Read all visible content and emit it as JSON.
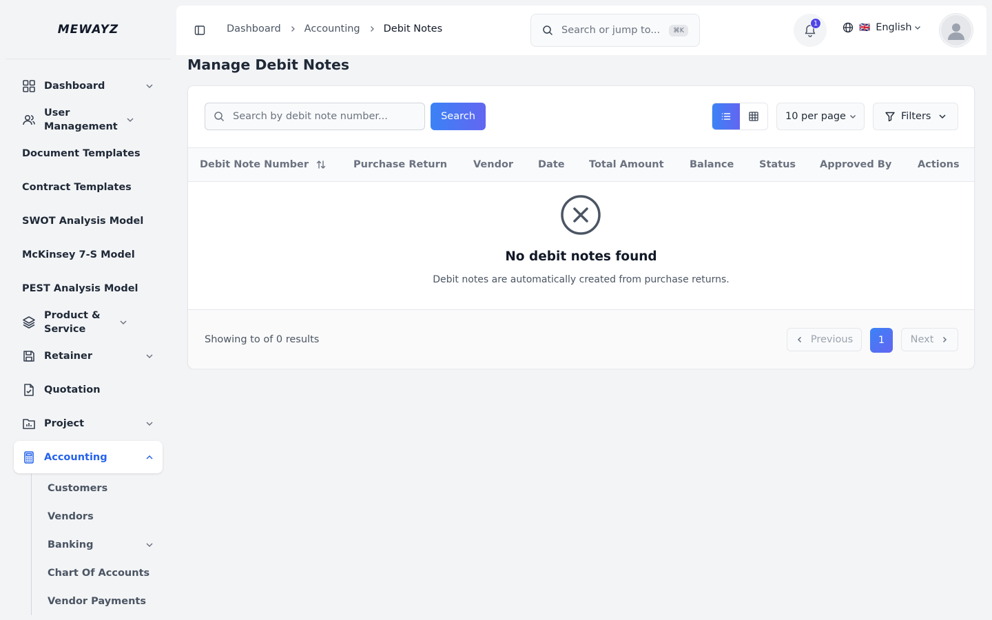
{
  "app": {
    "logo_text": "MEWAYZ"
  },
  "sidebar": {
    "items": [
      {
        "label": "Dashboard",
        "icon": "grid-icon",
        "has_chevron": true
      },
      {
        "label": "User Management",
        "icon": "users-icon",
        "has_chevron": true
      },
      {
        "label": "Document Templates"
      },
      {
        "label": "Contract Templates"
      },
      {
        "label": "SWOT Analysis Model"
      },
      {
        "label": "McKinsey 7-S Model"
      },
      {
        "label": "PEST Analysis Model"
      },
      {
        "label": "Product & Service",
        "icon": "layers-icon",
        "has_chevron": true
      },
      {
        "label": "Retainer",
        "icon": "save-icon",
        "has_chevron": true
      },
      {
        "label": "Quotation",
        "icon": "file-check-icon"
      },
      {
        "label": "Project",
        "icon": "folder-chart-icon",
        "has_chevron": true
      },
      {
        "label": "Accounting",
        "icon": "calculator-icon",
        "has_chevron": true,
        "active": true
      }
    ],
    "accounting_sub": [
      {
        "label": "Customers"
      },
      {
        "label": "Vendors"
      },
      {
        "label": "Banking",
        "has_chevron": true
      },
      {
        "label": "Chart Of Accounts"
      },
      {
        "label": "Vendor Payments"
      }
    ]
  },
  "topbar": {
    "breadcrumb": [
      "Dashboard",
      "Accounting",
      "Debit Notes"
    ],
    "search_placeholder": "Search or jump to...",
    "search_shortcut": "⌘K",
    "notification_count": "1",
    "language": "English",
    "language_flag": "🇬🇧"
  },
  "page": {
    "title": "Manage Debit Notes",
    "search_placeholder": "Search by debit note number...",
    "search_button": "Search",
    "per_page": "10 per page",
    "filters_label": "Filters",
    "columns": [
      "Debit Note Number",
      "Purchase Return",
      "Vendor",
      "Date",
      "Total Amount",
      "Balance",
      "Status",
      "Approved By",
      "Actions"
    ],
    "empty_title": "No debit notes found",
    "empty_desc": "Debit notes are automatically created from purchase returns.",
    "showing_text": "Showing to of 0 results",
    "prev_label": "Previous",
    "current_page": "1",
    "next_label": "Next"
  },
  "colors": {
    "accent": "#3b82f6",
    "accent_end": "#6366f1",
    "active_text": "#2563eb"
  }
}
